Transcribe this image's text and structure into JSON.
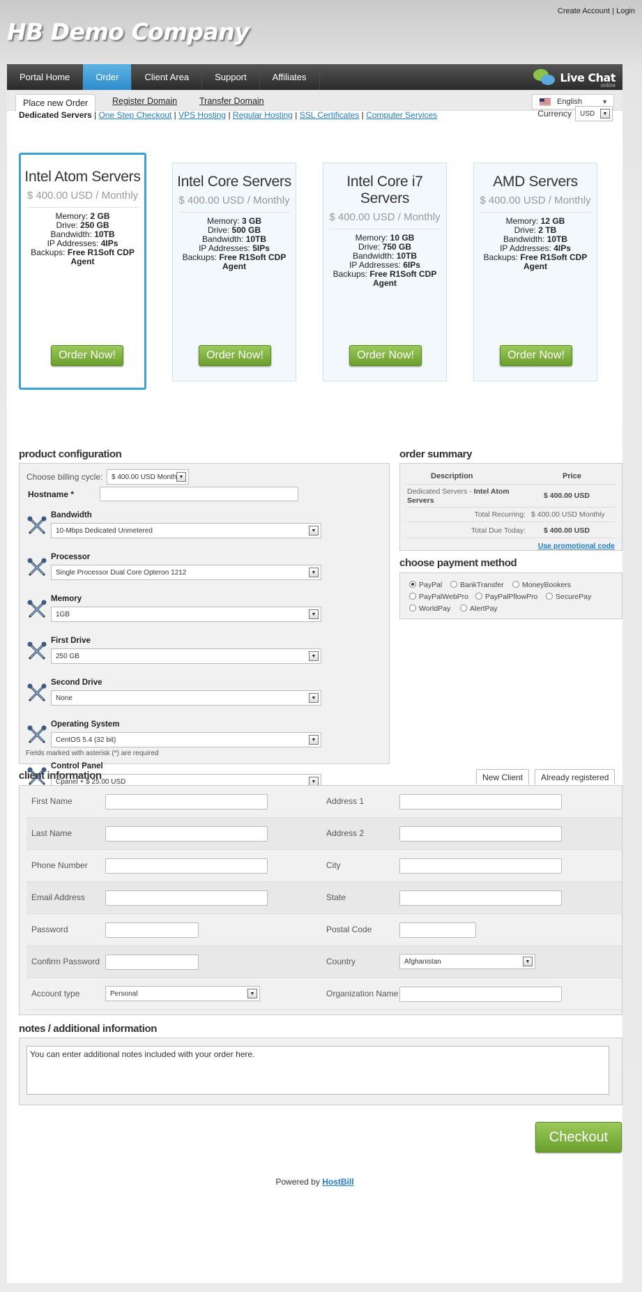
{
  "header": {
    "create_account": "Create Account",
    "separator": "|",
    "login": "Login",
    "company": "HB Demo Company"
  },
  "nav": {
    "items": [
      "Portal Home",
      "Order",
      "Client Area",
      "Support",
      "Affiliates"
    ],
    "active": "Order",
    "livechat_title": "Live Chat",
    "livechat_status": "online"
  },
  "subnav": {
    "tabs": [
      "Place new Order",
      "Register Domain",
      "Transfer Domain"
    ],
    "language": "English"
  },
  "categories": {
    "current": "Dedicated Servers",
    "links": [
      "One Step Checkout",
      "VPS Hosting",
      "Regular Hosting",
      "SSL Certificates",
      "Computer Services"
    ],
    "currency_label": "Currency",
    "currency_value": "USD"
  },
  "plans": [
    {
      "name": "Intel Atom Servers",
      "price": "$ 400.00 USD / Monthly",
      "memory": "2 GB",
      "drive": "250 GB",
      "bandwidth": "10TB",
      "ips": "4IPs",
      "backups": "Free R1Soft CDP Agent",
      "button": "Order Now!"
    },
    {
      "name": "Intel Core Servers",
      "price": "$ 400.00 USD / Monthly",
      "memory": "3 GB",
      "drive": "500 GB",
      "bandwidth": "10TB",
      "ips": "5IPs",
      "backups": "Free R1Soft CDP Agent",
      "button": "Order Now!"
    },
    {
      "name": "Intel Core i7 Servers",
      "price": "$ 400.00 USD / Monthly",
      "memory": "10 GB",
      "drive": "750 GB",
      "bandwidth": "10TB",
      "ips": "6IPs",
      "backups": "Free R1Soft CDP Agent",
      "button": "Order Now!"
    },
    {
      "name": "AMD Servers",
      "price": "$ 400.00 USD / Monthly",
      "memory": "12 GB",
      "drive": "2 TB",
      "bandwidth": "10TB",
      "ips": "4IPs",
      "backups": "Free R1Soft CDP Agent",
      "button": "Order Now!"
    }
  ],
  "spec_labels": {
    "memory": "Memory:",
    "drive": "Drive:",
    "bandwidth": "Bandwidth:",
    "ips": "IP Addresses:",
    "backups": "Backups:"
  },
  "config": {
    "title": "product configuration",
    "billing_label": "Choose billing cycle:",
    "billing_value": "$ 400.00 USD Monthly",
    "hostname_label": "Hostname *",
    "hostname_value": "",
    "options": [
      {
        "label": "Bandwidth",
        "value": "10-Mbps Dedicated Unmetered"
      },
      {
        "label": "Processor",
        "value": "Single Processor Dual Core Opteron 1212"
      },
      {
        "label": "Memory",
        "value": "1GB"
      },
      {
        "label": "First Drive",
        "value": "250 GB"
      },
      {
        "label": "Second Drive",
        "value": "None"
      },
      {
        "label": "Operating System",
        "value": "CentOS 5.4 (32 bit)"
      },
      {
        "label": "Control Panel",
        "value": "Cpanel + $ 25.00 USD"
      }
    ],
    "required_note": "Fields marked with asterisk (*) are required"
  },
  "summary": {
    "title": "order summary",
    "col_description": "Description",
    "col_price": "Price",
    "item_prefix": "Dedicated Servers - ",
    "item_name": "Intel Atom Servers",
    "item_price": "$ 400.00 USD",
    "recurring_label": "Total Recurring:",
    "recurring_value": "$ 400.00 USD Monthly",
    "due_label": "Total Due Today:",
    "due_value": "$ 400.00 USD",
    "promo": "Use promotional code"
  },
  "payment": {
    "title": "choose payment method",
    "methods": [
      "PayPal",
      "BankTransfer",
      "MoneyBookers",
      "PayPalWebPro",
      "PayPalPflowPro",
      "SecurePay",
      "WorldPay",
      "AlertPay"
    ],
    "selected": "PayPal"
  },
  "client": {
    "title": "client information",
    "tab_new": "New Client",
    "tab_registered": "Already registered",
    "left": [
      "First Name",
      "Last Name",
      "Phone Number",
      "Email Address",
      "Password",
      "Confirm Password",
      "Account type"
    ],
    "right": [
      "Address 1",
      "Address 2",
      "City",
      "State",
      "Postal Code",
      "Country",
      "Organization Name"
    ],
    "country": "Afghanistan",
    "account_type": "Personal"
  },
  "notes": {
    "title": "notes / additional information",
    "placeholder": "You can enter additional notes included with your order here."
  },
  "checkout": "Checkout",
  "footer": {
    "powered": "Powered by",
    "link": "HostBill"
  },
  "colors": {
    "accent": "#3aa0d8",
    "green": "#7cb342",
    "link": "#1e7bc8"
  }
}
